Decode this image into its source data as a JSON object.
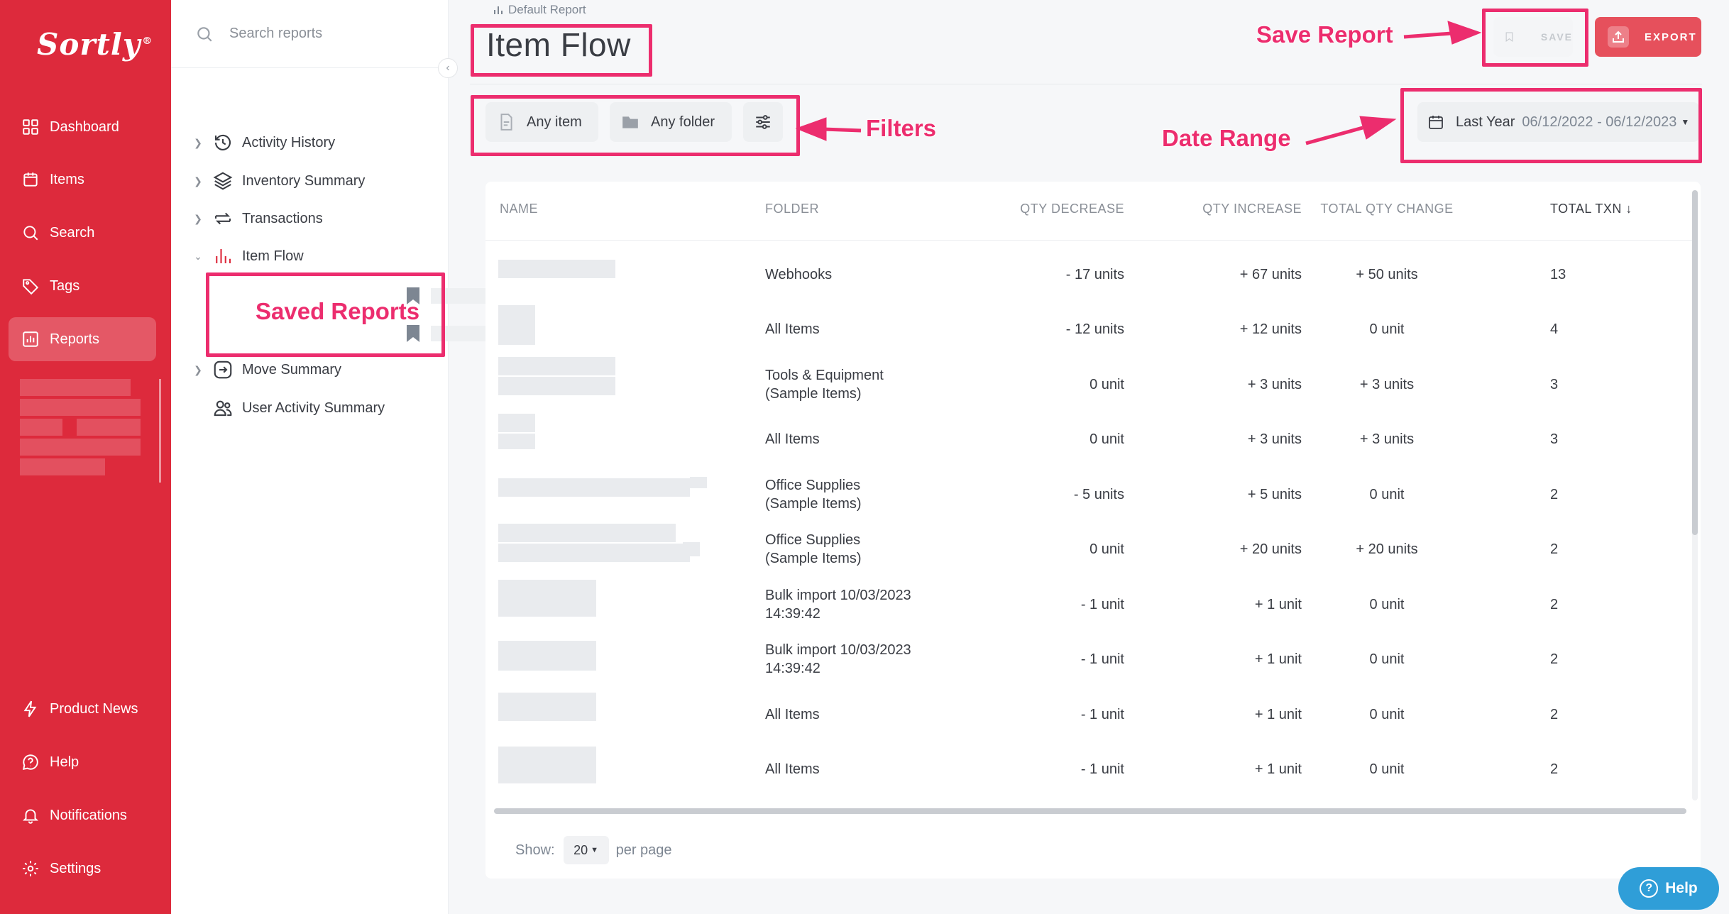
{
  "app": {
    "logo": "Sortly",
    "logo_mark": "®"
  },
  "nav": {
    "top": [
      {
        "label": "Dashboard",
        "icon": "dashboard-icon"
      },
      {
        "label": "Items",
        "icon": "items-icon"
      },
      {
        "label": "Search",
        "icon": "search-icon"
      },
      {
        "label": "Tags",
        "icon": "tag-icon"
      },
      {
        "label": "Reports",
        "icon": "reports-icon",
        "active": true
      }
    ],
    "bottom": [
      {
        "label": "Product News",
        "icon": "lightning-icon"
      },
      {
        "label": "Help",
        "icon": "help-icon"
      },
      {
        "label": "Notifications",
        "icon": "bell-icon"
      },
      {
        "label": "Settings",
        "icon": "gear-icon"
      }
    ]
  },
  "reports_panel": {
    "search_placeholder": "Search reports",
    "items": [
      {
        "label": "Activity History",
        "icon": "history-icon"
      },
      {
        "label": "Inventory Summary",
        "icon": "layers-icon"
      },
      {
        "label": "Transactions",
        "icon": "transactions-icon"
      },
      {
        "label": "Item Flow",
        "icon": "bar-chart-icon",
        "expanded": true,
        "active": true
      },
      {
        "label": "Move Summary",
        "icon": "move-icon"
      },
      {
        "label": "User Activity Summary",
        "icon": "users-icon"
      }
    ]
  },
  "header": {
    "breadcrumb": "Default Report",
    "title": "Item Flow",
    "save_label": "SAVE",
    "export_label": "EXPORT"
  },
  "filters": {
    "item": "Any item",
    "folder": "Any folder",
    "date_preset": "Last Year",
    "date_range": "06/12/2022 - 06/12/2023"
  },
  "table": {
    "columns": [
      "NAME",
      "FOLDER",
      "QTY DECREASE",
      "QTY INCREASE",
      "TOTAL QTY CHANGE",
      "TOTAL TXN"
    ],
    "rows": [
      {
        "folder": [
          "Webhooks"
        ],
        "dec": "- 17 units",
        "inc": "+ 67 units",
        "change": "+ 50 units",
        "txn": "13"
      },
      {
        "folder": [
          "All Items"
        ],
        "dec": "- 12 units",
        "inc": "+ 12 units",
        "change": "0 unit",
        "txn": "4"
      },
      {
        "folder": [
          "Tools & Equipment",
          "(Sample Items)"
        ],
        "dec": "0 unit",
        "inc": "+ 3 units",
        "change": "+ 3 units",
        "txn": "3"
      },
      {
        "folder": [
          "All Items"
        ],
        "dec": "0 unit",
        "inc": "+ 3 units",
        "change": "+ 3 units",
        "txn": "3"
      },
      {
        "folder": [
          "Office Supplies",
          "(Sample Items)"
        ],
        "dec": "- 5 units",
        "inc": "+ 5 units",
        "change": "0 unit",
        "txn": "2"
      },
      {
        "folder": [
          "Office Supplies",
          "(Sample Items)"
        ],
        "dec": "0 unit",
        "inc": "+ 20 units",
        "change": "+ 20 units",
        "txn": "2"
      },
      {
        "folder": [
          "Bulk import 10/03/2023",
          "14:39:42"
        ],
        "dec": "- 1 unit",
        "inc": "+ 1 unit",
        "change": "0 unit",
        "txn": "2"
      },
      {
        "folder": [
          "Bulk import 10/03/2023",
          "14:39:42"
        ],
        "dec": "- 1 unit",
        "inc": "+ 1 unit",
        "change": "0 unit",
        "txn": "2"
      },
      {
        "folder": [
          "All Items"
        ],
        "dec": "- 1 unit",
        "inc": "+ 1 unit",
        "change": "0 unit",
        "txn": "2"
      },
      {
        "folder": [
          "All Items"
        ],
        "dec": "- 1 unit",
        "inc": "+ 1 unit",
        "change": "0 unit",
        "txn": "2"
      }
    ]
  },
  "pagination": {
    "show_label": "Show:",
    "per_page_value": "20",
    "per_page_label": "per page"
  },
  "help_widget": {
    "label": "Help"
  },
  "annotations": {
    "save_report": "Save Report",
    "filters": "Filters",
    "date_range": "Date Range",
    "saved_reports": "Saved Reports"
  },
  "colors": {
    "brand": "#dd2a3c",
    "annotation": "#ec2d6e",
    "help": "#2f9ed8"
  }
}
